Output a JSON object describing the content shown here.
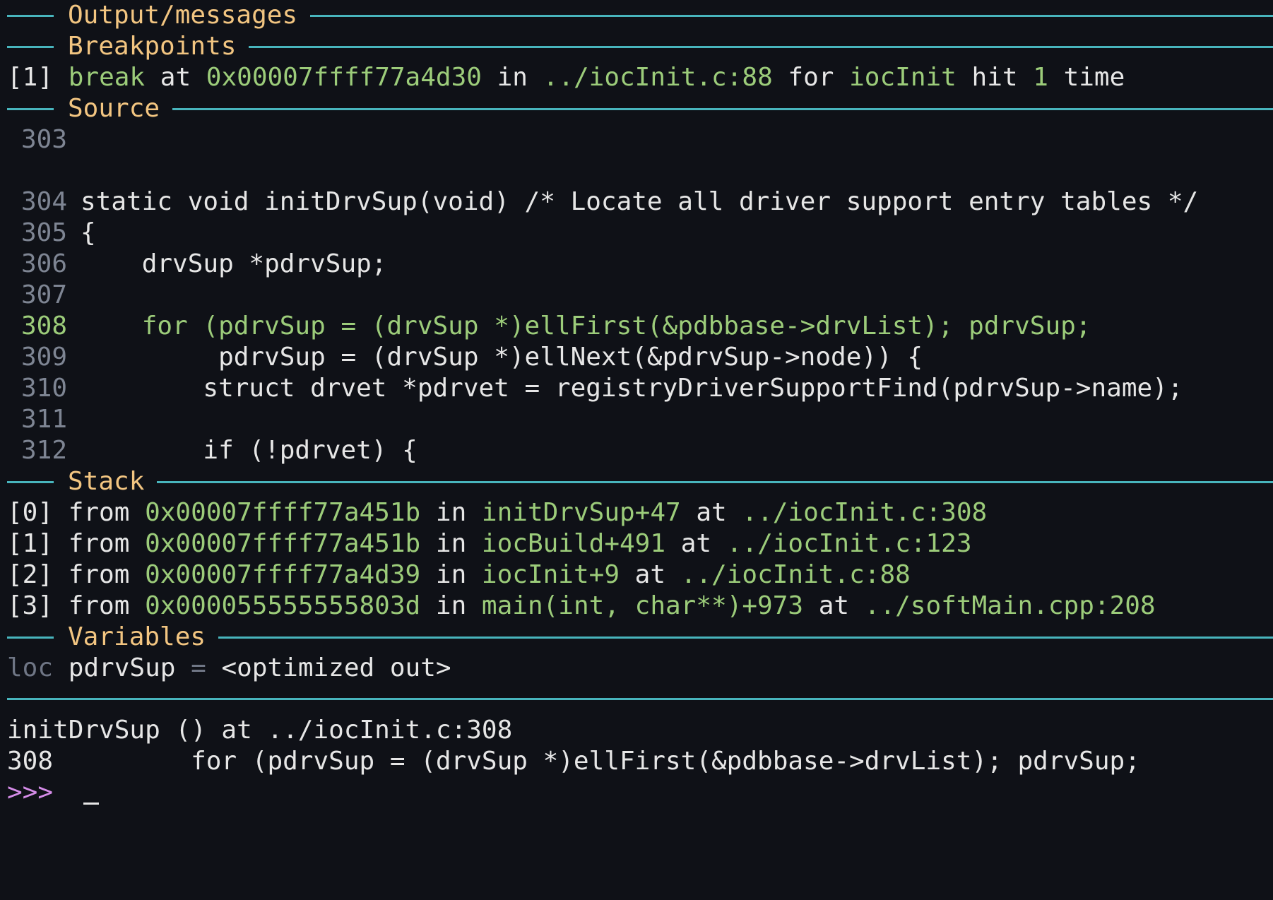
{
  "sections": {
    "output": "Output/messages",
    "breakpoints": "Breakpoints",
    "source": "Source",
    "stack": "Stack",
    "variables": "Variables"
  },
  "breakpoint": {
    "index": "[1]",
    "kind": "break",
    "at_word": " at ",
    "address": "0x00007ffff77a4d30",
    "in_word": " in ",
    "location": "../iocInit.c:88",
    "for_word": " for ",
    "function": "iocInit",
    "hit_word": " hit ",
    "count": "1",
    "time_word": " time"
  },
  "source": {
    "lines": [
      {
        "num": "303",
        "text": ""
      },
      {
        "num": "304",
        "text": "static void initDrvSup(void) /* Locate all driver support entry tables */"
      },
      {
        "num": "305",
        "text": "{"
      },
      {
        "num": "306",
        "text": "    drvSup *pdrvSup;"
      },
      {
        "num": "307",
        "text": ""
      },
      {
        "num": "308",
        "text": "    for (pdrvSup = (drvSup *)ellFirst(&pdbbase->drvList); pdrvSup;"
      },
      {
        "num": "309",
        "text": "         pdrvSup = (drvSup *)ellNext(&pdrvSup->node)) {"
      },
      {
        "num": "310",
        "text": "        struct drvet *pdrvet = registryDriverSupportFind(pdrvSup->name);"
      },
      {
        "num": "311",
        "text": ""
      },
      {
        "num": "312",
        "text": "        if (!pdrvet) {"
      }
    ]
  },
  "stack": {
    "frames": [
      {
        "index": "[0]",
        "from_word": " from ",
        "address": "0x00007ffff77a451b",
        "in_word": " in ",
        "func": "initDrvSup+47",
        "at_word": " at ",
        "location": "../iocInit.c:308"
      },
      {
        "index": "[1]",
        "from_word": " from ",
        "address": "0x00007ffff77a451b",
        "in_word": " in ",
        "func": "iocBuild+491",
        "at_word": " at ",
        "location": "../iocInit.c:123"
      },
      {
        "index": "[2]",
        "from_word": " from ",
        "address": "0x00007ffff77a4d39",
        "in_word": " in ",
        "func": "iocInit+9",
        "at_word": " at ",
        "location": "../iocInit.c:88"
      },
      {
        "index": "[3]",
        "from_word": " from ",
        "address": "0x000055555555803d",
        "in_word": " in ",
        "func": "main(int, char**)+973",
        "at_word": " at ",
        "location": "../softMain.cpp:208"
      }
    ]
  },
  "variables": {
    "scope": "loc",
    "name": " pdrvSup",
    "equals": " = ",
    "value": "<optimized out>"
  },
  "console": {
    "line1": "initDrvSup () at ../iocInit.c:308",
    "line2": "308\t    for (pdrvSup = (drvSup *)ellFirst(&pdbbase->drvList); pdrvSup;",
    "prompt": ">>>"
  },
  "colors": {
    "background": "#0f1117",
    "rule": "#48b5bd",
    "section_label": "#f2c581",
    "accent_green": "#9ccc7a",
    "prompt": "#d58ce8"
  }
}
